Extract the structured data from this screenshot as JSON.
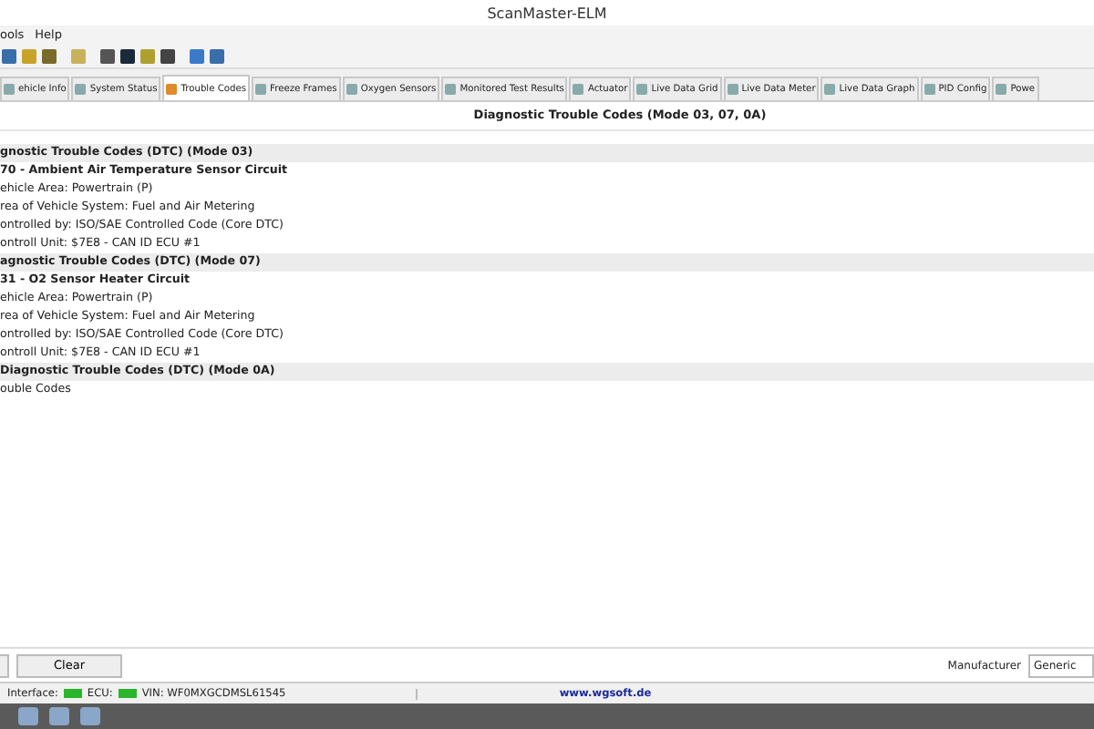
{
  "window": {
    "title": "ScanMaster-ELM"
  },
  "menu": [
    "ools",
    "Help"
  ],
  "tabs": [
    {
      "label": "ehicle Info",
      "selected": false
    },
    {
      "label": "System Status",
      "selected": false
    },
    {
      "label": "Trouble Codes",
      "selected": true
    },
    {
      "label": "Freeze Frames",
      "selected": false
    },
    {
      "label": "Oxygen Sensors",
      "selected": false
    },
    {
      "label": "Monitored Test Results",
      "selected": false
    },
    {
      "label": "Actuator",
      "selected": false
    },
    {
      "label": "Live Data Grid",
      "selected": false
    },
    {
      "label": "Live Data Meter",
      "selected": false
    },
    {
      "label": "Live Data Graph",
      "selected": false
    },
    {
      "label": "PID Config",
      "selected": false
    },
    {
      "label": "Powe",
      "selected": false
    }
  ],
  "panel_title": "Diagnostic Trouble Codes (Mode 03, 07, 0A)",
  "rows": [
    {
      "kind": "section",
      "text": "gnostic Trouble Codes (DTC) (Mode 03)"
    },
    {
      "kind": "code",
      "text": "70 - Ambient Air Temperature Sensor Circuit"
    },
    {
      "kind": "detail",
      "text": "ehicle Area: Powertrain (P)"
    },
    {
      "kind": "detail",
      "text": "rea of Vehicle System: Fuel and Air Metering"
    },
    {
      "kind": "detail",
      "text": "ontrolled by: ISO/SAE Controlled Code (Core DTC)"
    },
    {
      "kind": "detail",
      "text": "ontroll Unit: $7E8 - CAN ID ECU #1"
    },
    {
      "kind": "section",
      "text": "agnostic Trouble Codes (DTC) (Mode 07)"
    },
    {
      "kind": "code",
      "text": "31 - O2 Sensor Heater Circuit"
    },
    {
      "kind": "detail",
      "text": "ehicle Area: Powertrain (P)"
    },
    {
      "kind": "detail",
      "text": "rea of Vehicle System: Fuel and Air Metering"
    },
    {
      "kind": "detail",
      "text": "ontrolled by: ISO/SAE Controlled Code (Core DTC)"
    },
    {
      "kind": "detail",
      "text": "ontroll Unit: $7E8 - CAN ID ECU #1"
    },
    {
      "kind": "section",
      "text": "Diagnostic Trouble Codes (DTC) (Mode 0A)"
    },
    {
      "kind": "detail",
      "text": "ouble Codes"
    }
  ],
  "buttons": {
    "clear": "Clear"
  },
  "manufacturer": {
    "label": "Manufacturer",
    "value": "Generic"
  },
  "status_bar": {
    "interface_label": "Interface:",
    "interface_ok": true,
    "ecu_label": "ECU:",
    "ecu_ok": true,
    "vin": "VIN: WF0MXGCDMSL61545",
    "website": "www.wgsoft.de"
  }
}
